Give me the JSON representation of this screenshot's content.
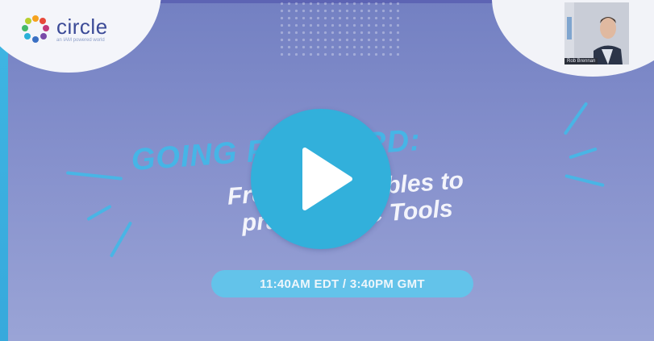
{
  "logo": {
    "name": "circle",
    "tagline": "an IAM powered world"
  },
  "presenter": {
    "name_tag": "Rob Brennan"
  },
  "slide": {
    "title_line1": "GOING FORWARD:",
    "title_line2a": "From deliverables to",
    "title_line2b": "practical CC Tools",
    "time": "11:40AM EDT / 3:40PM GMT"
  },
  "player": {
    "play_icon": "play-icon"
  },
  "colors": {
    "background": "#8590cc",
    "accent_blue": "#32b0db",
    "title_blue": "#46b5e6",
    "pill_blue": "#63c3ea",
    "left_strip": "#3fb6e3"
  }
}
